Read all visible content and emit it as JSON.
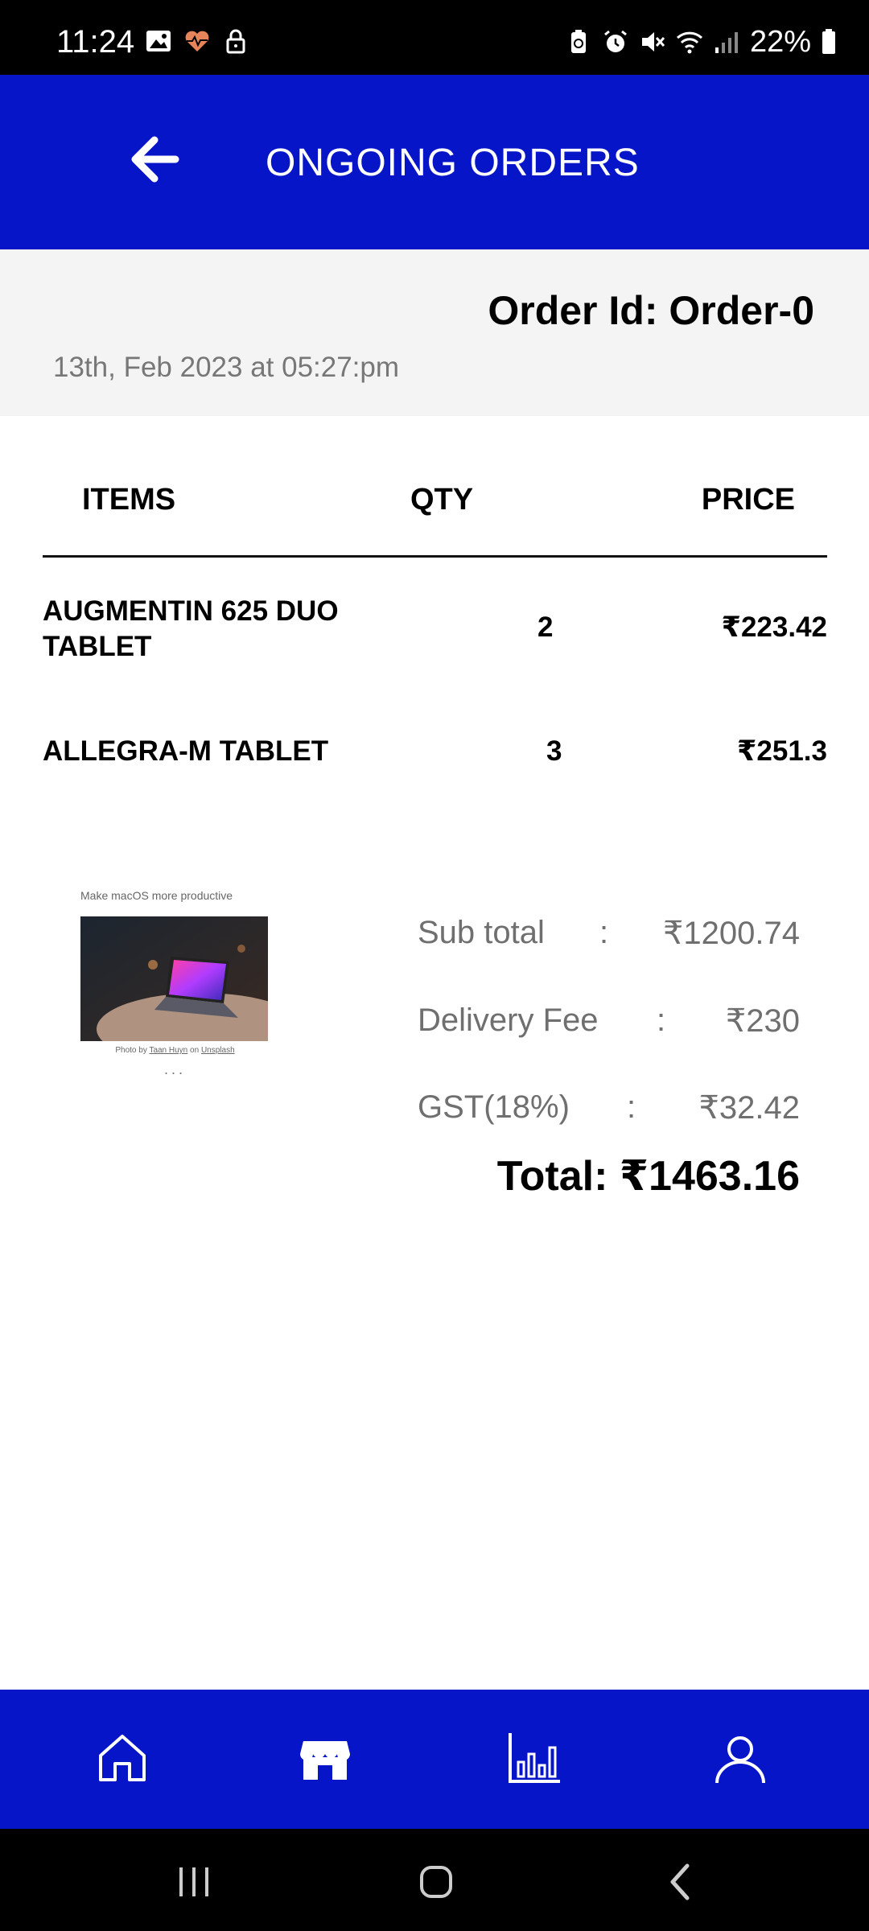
{
  "status_bar": {
    "time": "11:24",
    "battery_percent": "22%",
    "left_icons": [
      "image-icon",
      "heart-rate-icon",
      "lock-icon"
    ],
    "right_icons": [
      "battery-saver-icon",
      "alarm-icon",
      "mute-icon",
      "wifi-icon",
      "signal-icon",
      "battery-icon"
    ]
  },
  "app_bar": {
    "title": "ONGOING ORDERS",
    "back_icon": "arrow-left-icon",
    "background": "#0715c9"
  },
  "order": {
    "id_label": "Order Id: Order-0",
    "date": "13th, Feb 2023 at 05:27:pm"
  },
  "table": {
    "headers": {
      "items": "ITEMS",
      "qty": "QTY",
      "price": "PRICE"
    },
    "rows": [
      {
        "name_line1": "AUGMENTIN 625 DUO",
        "name_line2": "TABLET",
        "qty": "2",
        "price": "₹223.42"
      },
      {
        "name_line1": "ALLEGRA-M TABLET",
        "name_line2": "",
        "qty": "3",
        "price": "₹251.3"
      }
    ]
  },
  "promo": {
    "caption": "Make macOS more productive",
    "credit_prefix": "Photo by ",
    "credit_author": "Taan Huyn",
    "credit_mid": " on ",
    "credit_site": "Unsplash",
    "dots": "..."
  },
  "summary": {
    "subtotal_label": "Sub total",
    "subtotal_value": "₹1200.74",
    "delivery_label": "Delivery Fee",
    "delivery_value": "₹230",
    "gst_label": "GST(18%)",
    "gst_value": "₹32.42",
    "colon": ":",
    "total": "Total: ₹1463.16"
  },
  "bottom_nav": {
    "items": [
      "home-icon",
      "store-icon",
      "stats-icon",
      "profile-icon"
    ],
    "active": "store-icon"
  },
  "system_nav": [
    "recents-icon",
    "home-circle-icon",
    "back-chevron-icon"
  ]
}
